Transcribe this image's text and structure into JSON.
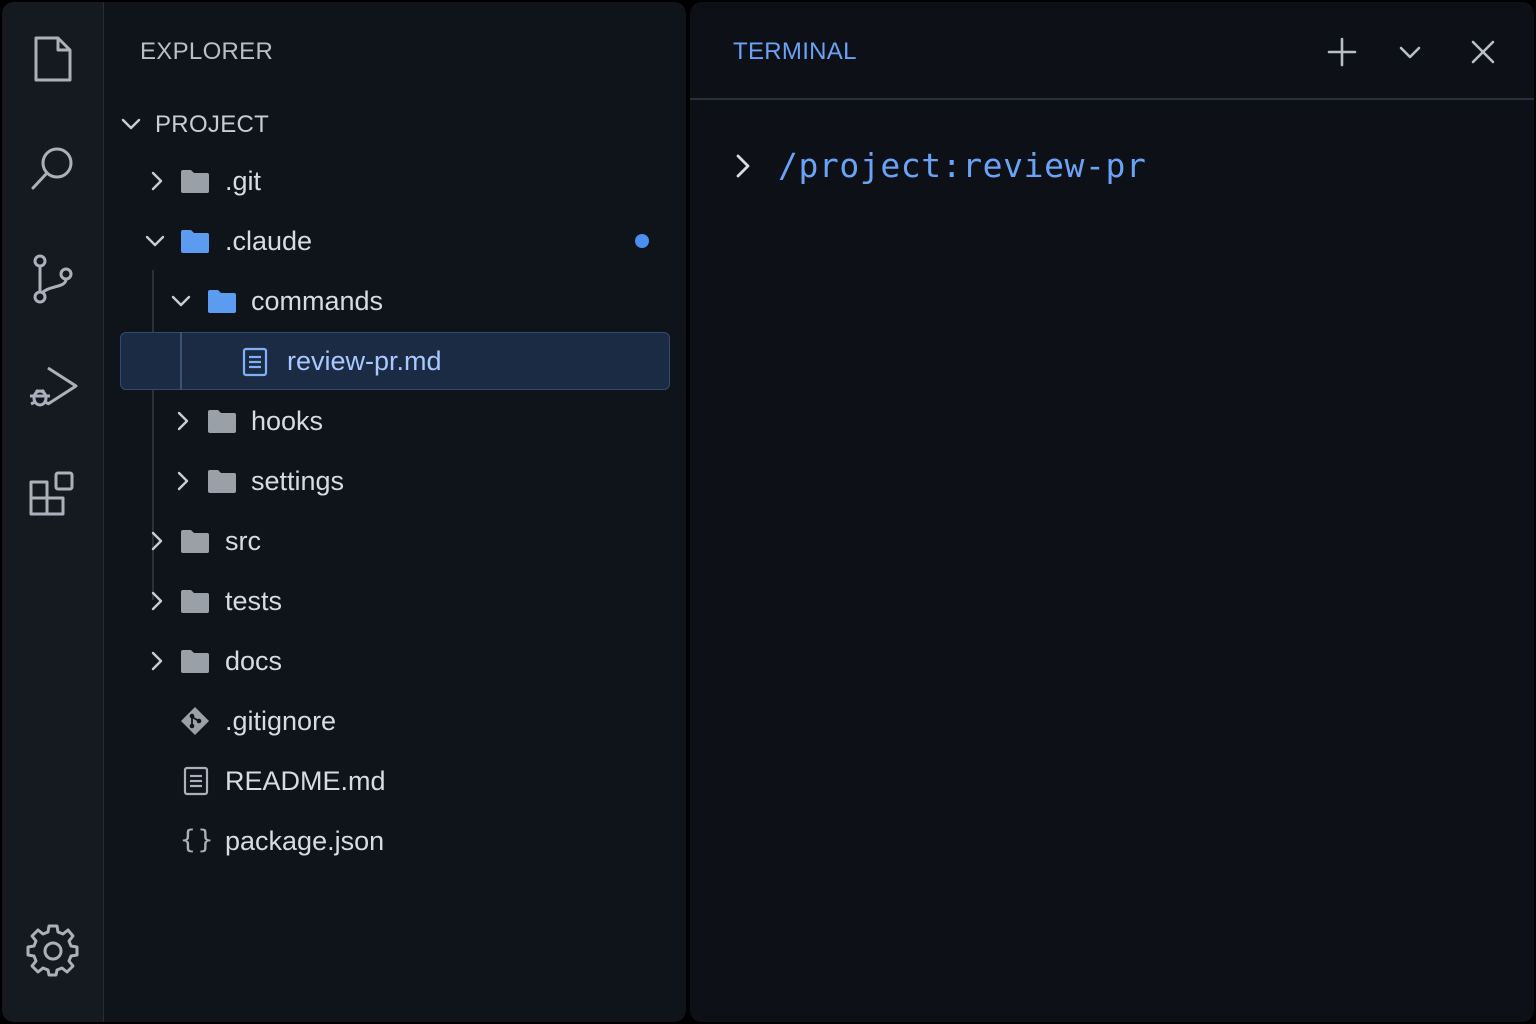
{
  "colors": {
    "accent": "#6aa3f5",
    "folder_open": "#5b9cf0",
    "folder_closed": "#9aa0a8",
    "modified_dot": "#4c8ef0",
    "text": "#d8dce2",
    "icon": "#aab1bb"
  },
  "activity_bar": {
    "items": [
      {
        "name": "explorer",
        "icon": "files-icon"
      },
      {
        "name": "search",
        "icon": "search-icon"
      },
      {
        "name": "source-control",
        "icon": "source-control-icon"
      },
      {
        "name": "run-debug",
        "icon": "run-debug-icon"
      },
      {
        "name": "extensions",
        "icon": "extensions-icon"
      },
      {
        "name": "settings",
        "icon": "gear-icon"
      }
    ]
  },
  "explorer": {
    "title": "EXPLORER",
    "root": {
      "label": "PROJECT",
      "expanded": true
    },
    "items": [
      {
        "label": ".git",
        "type": "folder",
        "expanded": false
      },
      {
        "label": ".claude",
        "type": "folder",
        "expanded": true,
        "modified": true
      },
      {
        "label": "commands",
        "type": "folder",
        "expanded": true
      },
      {
        "label": "review-pr.md",
        "type": "file",
        "icon": "markdown-file-icon",
        "selected": true
      },
      {
        "label": "hooks",
        "type": "folder",
        "expanded": false
      },
      {
        "label": "settings",
        "type": "folder",
        "expanded": false
      },
      {
        "label": "src",
        "type": "folder",
        "expanded": false
      },
      {
        "label": "tests",
        "type": "folder",
        "expanded": false
      },
      {
        "label": "docs",
        "type": "folder",
        "expanded": false
      },
      {
        "label": ".gitignore",
        "type": "file",
        "icon": "git-file-icon"
      },
      {
        "label": "README.md",
        "type": "file",
        "icon": "document-file-icon"
      },
      {
        "label": "package.json",
        "type": "file",
        "icon": "json-file-icon"
      }
    ]
  },
  "terminal": {
    "title": "TERMINAL",
    "buttons": [
      {
        "name": "new-terminal",
        "icon": "plus-icon"
      },
      {
        "name": "terminal-menu",
        "icon": "chevron-down-icon"
      },
      {
        "name": "close-terminal",
        "icon": "close-icon"
      }
    ],
    "command": "/project:review-pr"
  }
}
